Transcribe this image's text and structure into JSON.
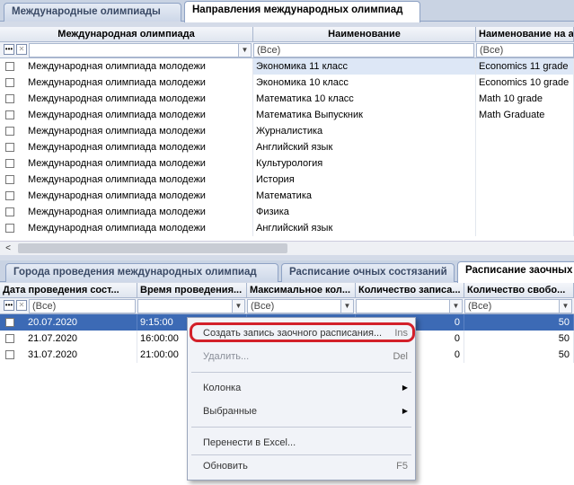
{
  "top_tabs": [
    "Международные олимпиады",
    "Направления международных олимпиад"
  ],
  "grid1": {
    "headers": [
      "Международная олимпиада",
      "Наименование",
      "Наименование на а"
    ],
    "filter": "(Все)",
    "rows": [
      [
        "Международная олимпиада молодежи",
        "Экономика 11 класс",
        "Economics 11 grade"
      ],
      [
        "Международная олимпиада молодежи",
        "Экономика 10 класс",
        "Economics 10 grade"
      ],
      [
        "Международная олимпиада молодежи",
        "Математика 10 класс",
        "Math 10 grade"
      ],
      [
        "Международная олимпиада молодежи",
        "Математика Выпускник",
        "Math Graduate"
      ],
      [
        "Международная олимпиада молодежи",
        "Журналистика",
        ""
      ],
      [
        "Международная олимпиада молодежи",
        "Английский язык",
        ""
      ],
      [
        "Международная олимпиада молодежи",
        "Культурология",
        ""
      ],
      [
        "Международная олимпиада молодежи",
        "История",
        ""
      ],
      [
        "Международная олимпиада молодежи",
        "Математика",
        ""
      ],
      [
        "Международная олимпиада молодежи",
        "Физика",
        ""
      ],
      [
        "Международная олимпиада молодежи",
        "Английский язык",
        ""
      ]
    ]
  },
  "scroll_arrow": "<",
  "bottom_tabs": [
    "Города проведения международных олимпиад",
    "Расписание очных состязаний",
    "Расписание заочных"
  ],
  "grid2": {
    "headers": [
      "Дата проведения сост...",
      "Время проведения...",
      "Максимальное кол...",
      "Количество записа...",
      "Количество свобо..."
    ],
    "filter": "(Все)",
    "rows": [
      [
        "20.07.2020",
        "9:15:00",
        "",
        "0",
        "50"
      ],
      [
        "21.07.2020",
        "16:00:00",
        "",
        "0",
        "50"
      ],
      [
        "31.07.2020",
        "21:00:00",
        "",
        "0",
        "50"
      ]
    ]
  },
  "context_menu": {
    "create": {
      "label": "Создать запись заочного расписания...",
      "shortcut": "Ins"
    },
    "delete": {
      "label": "Удалить...",
      "shortcut": "Del"
    },
    "column": {
      "label": "Колонка"
    },
    "selected": {
      "label": "Выбранные"
    },
    "export": {
      "label": "Перенести в Excel..."
    },
    "refresh": {
      "label": "Обновить",
      "shortcut": "F5"
    }
  }
}
